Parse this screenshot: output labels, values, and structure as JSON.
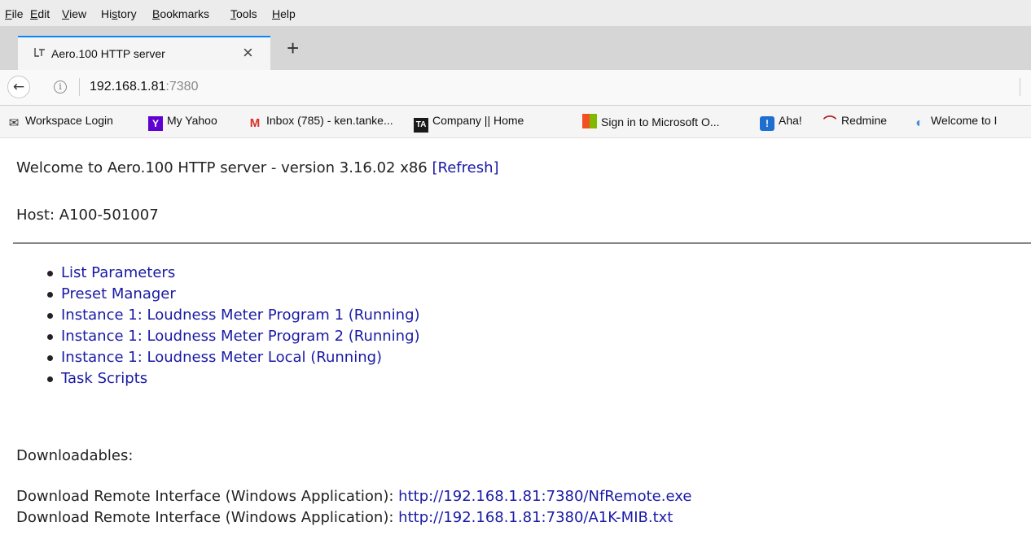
{
  "menubar": {
    "items": [
      {
        "pre": "",
        "key": "F",
        "post": "ile"
      },
      {
        "pre": "",
        "key": "E",
        "post": "dit"
      },
      {
        "pre": "",
        "key": "V",
        "post": "iew"
      },
      {
        "pre": "Hi",
        "key": "s",
        "post": "tory"
      },
      {
        "pre": "",
        "key": "B",
        "post": "ookmarks"
      },
      {
        "pre": "",
        "key": "T",
        "post": "ools"
      },
      {
        "pre": "",
        "key": "H",
        "post": "elp"
      }
    ]
  },
  "tab": {
    "title": "Aero.100 HTTP server",
    "close": "×"
  },
  "newtab": "+",
  "nav": {
    "back": "←",
    "info": "i",
    "url_host": "192.168.1.81",
    "url_port": ":7380"
  },
  "bookmarks": [
    {
      "label": "Workspace Login",
      "icon": "mail-icon",
      "glyph": "✉",
      "color": "#333333"
    },
    {
      "label": "My Yahoo",
      "icon": "yahoo-icon",
      "glyph": "Y",
      "color": "#5f01d1"
    },
    {
      "label": "Inbox (785) - ken.tanke...",
      "icon": "gmail-icon",
      "glyph": "M",
      "color": "#d93025"
    },
    {
      "label": "Company || Home",
      "icon": "ta-icon",
      "glyph": "TA",
      "color": "#1a1a1a"
    },
    {
      "label": "Sign in to Microsoft O...",
      "icon": "microsoft-icon",
      "glyph": "■",
      "color": "#f25022"
    },
    {
      "label": "Aha!",
      "icon": "aha-icon",
      "glyph": "!",
      "color": "#1f6fd1"
    },
    {
      "label": "Redmine",
      "icon": "redmine-icon",
      "glyph": "⌒",
      "color": "#b32024"
    },
    {
      "label": "Welcome to I",
      "icon": "globe-icon",
      "glyph": "◐",
      "color": "#4a90d9"
    }
  ],
  "page": {
    "welcome": "Welcome to Aero.100 HTTP server - version 3.16.02 x86",
    "refresh": "[Refresh]",
    "host": "Host: A100-501007",
    "menu_items": [
      "List Parameters",
      "Preset Manager",
      "Instance 1: Loudness Meter Program 1 (Running)",
      "Instance 1: Loudness Meter Program 2 (Running)",
      "Instance 1: Loudness Meter Local (Running)",
      "Task Scripts"
    ],
    "downloadables": "Downloadables:",
    "downloads": [
      {
        "label": "Download Remote Interface (Windows Application):",
        "url": "http://192.168.1.81:7380/NfRemote.exe"
      },
      {
        "label": "Download Remote Interface (Windows Application):",
        "url": "http://192.168.1.81:7380/A1K-MIB.txt"
      }
    ]
  }
}
